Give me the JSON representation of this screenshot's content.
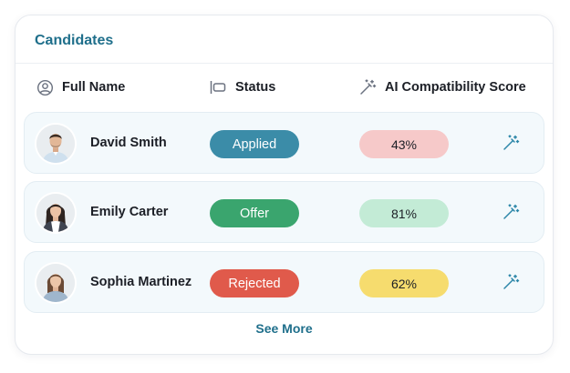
{
  "panel": {
    "title": "Candidates",
    "see_more_label": "See More"
  },
  "columns": {
    "name": "Full Name",
    "status": "Status",
    "score": "AI Compatibility Score"
  },
  "candidates": [
    {
      "name": "David Smith",
      "status": "Applied",
      "status_color": "#3b8ca8",
      "score": "43%",
      "score_color": "#f6c9c9"
    },
    {
      "name": "Emily Carter",
      "status": "Offer",
      "status_color": "#3aa56e",
      "score": "81%",
      "score_color": "#c3ebd6"
    },
    {
      "name": "Sophia Martinez",
      "status": "Rejected",
      "status_color": "#e05a4b",
      "score": "62%",
      "score_color": "#f6dc6e"
    }
  ],
  "icons": {
    "name_column": "user-circle-icon",
    "status_column": "tag-icon",
    "score_column": "magic-wand-icon",
    "row_action": "magic-wand-icon"
  },
  "colors": {
    "accent": "#1f6f8b",
    "row_bg": "#f3f9fc"
  }
}
